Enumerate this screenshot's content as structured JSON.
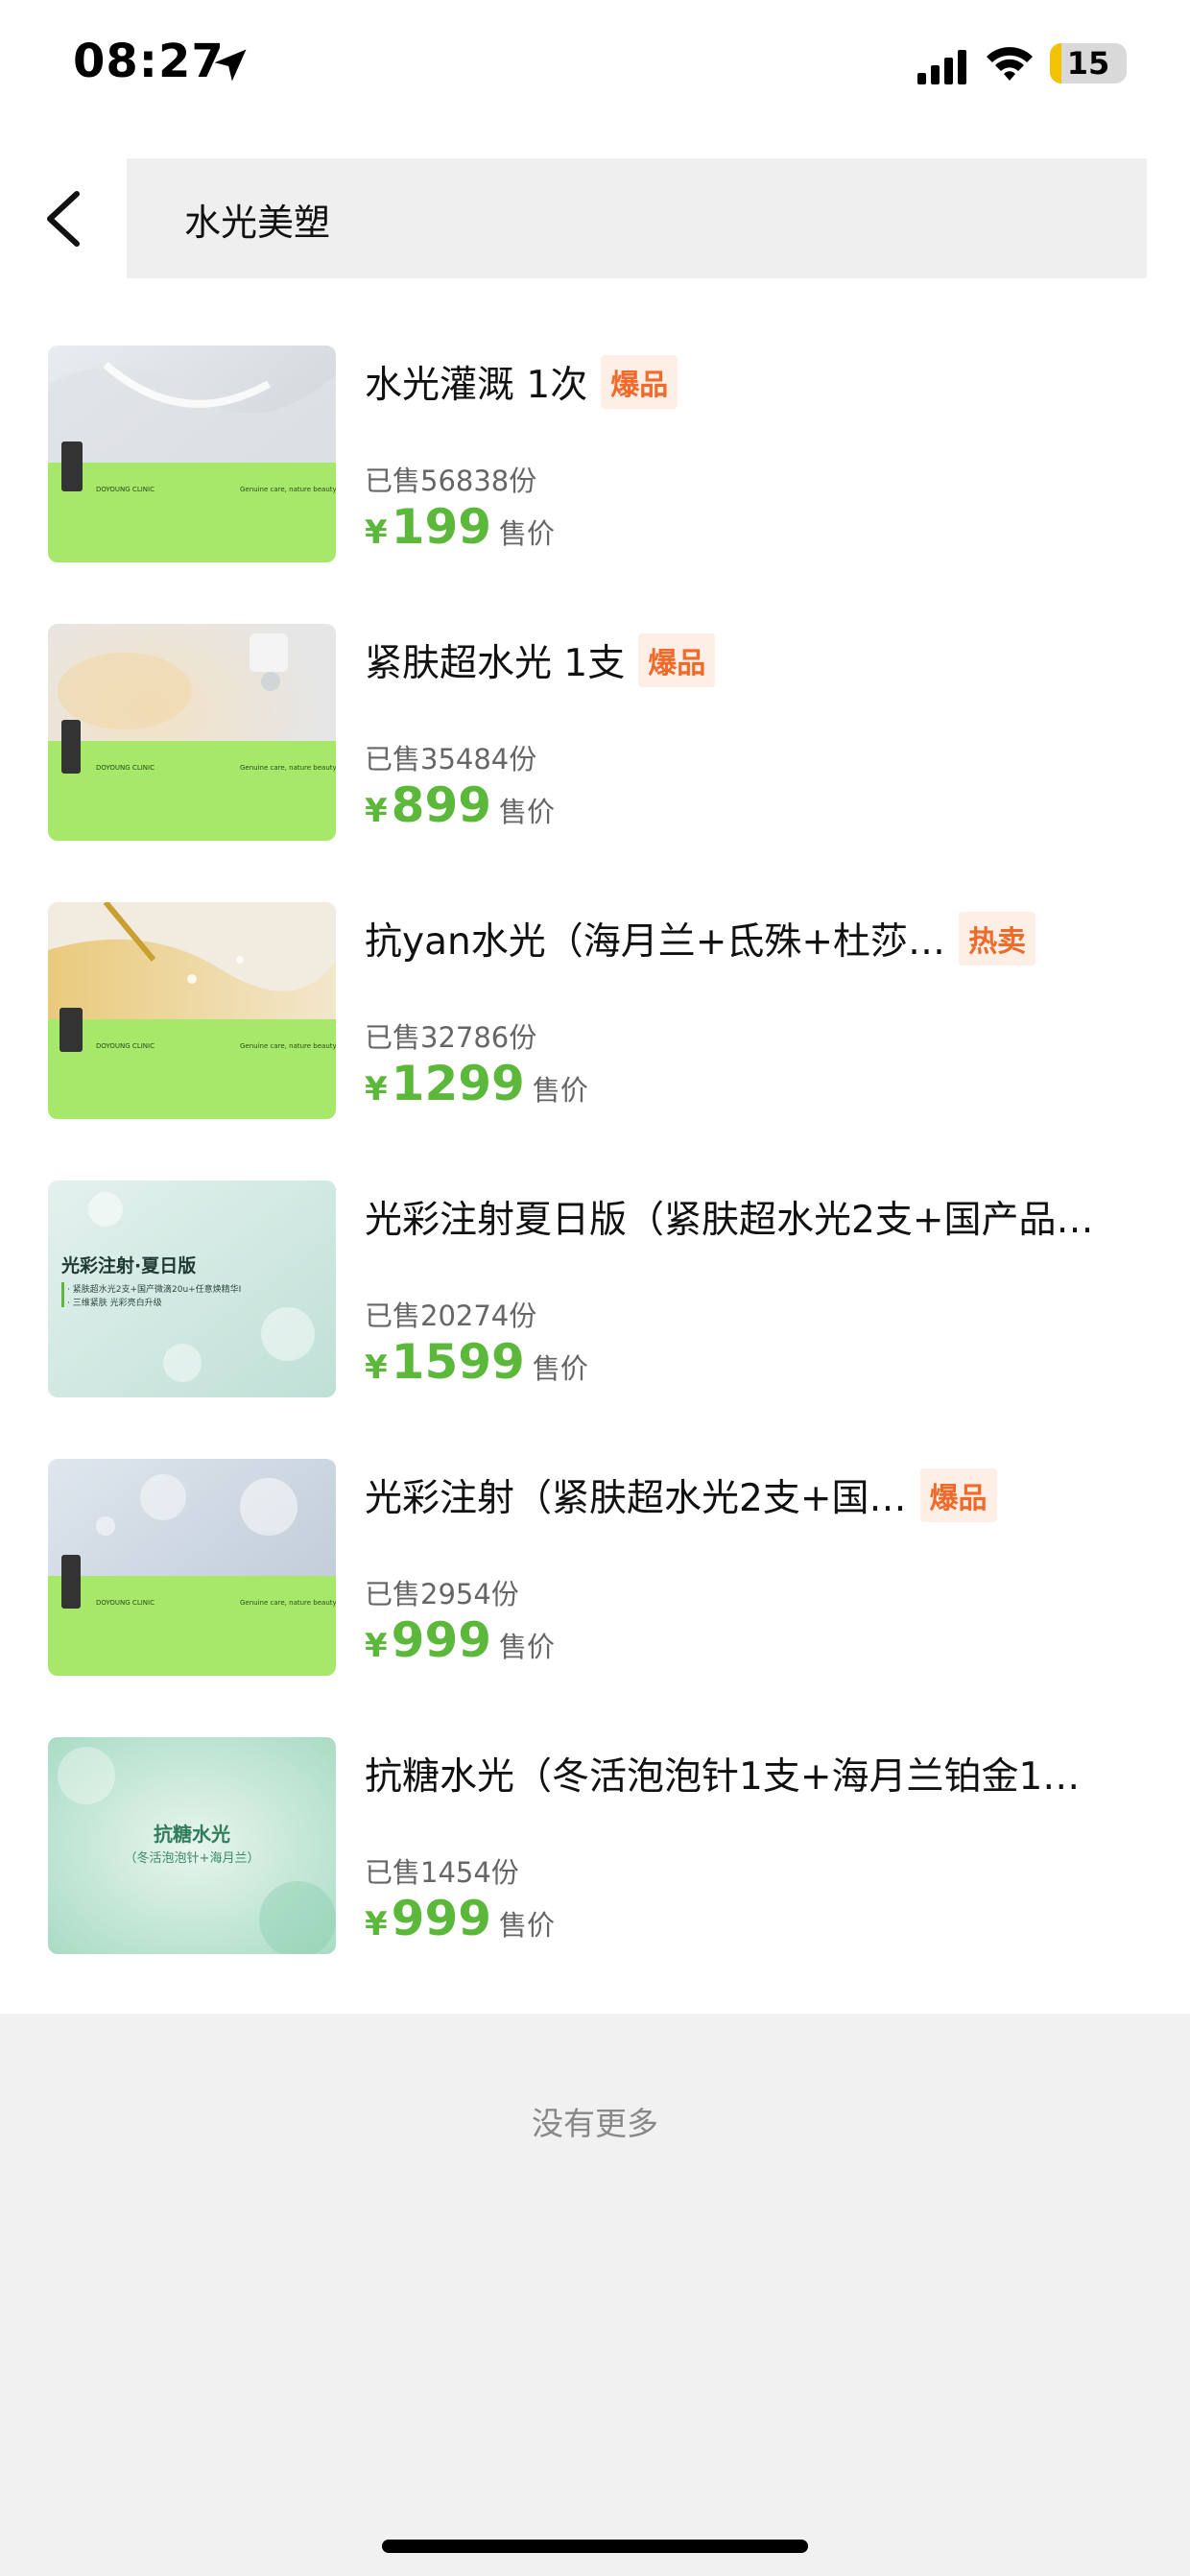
{
  "status_bar": {
    "time": "08:27",
    "battery": "15",
    "battery_level": 0.15
  },
  "search": {
    "query": "水光美塑"
  },
  "products": [
    {
      "title": "水光灌溉 1次",
      "badge": "爆品",
      "sold": "已售56838份",
      "currency": "¥",
      "price": "199",
      "price_label": "售价"
    },
    {
      "title": "紧肤超水光 1支",
      "badge": "爆品",
      "sold": "已售35484份",
      "currency": "¥",
      "price": "899",
      "price_label": "售价"
    },
    {
      "title": "抗yan水光（海月兰+氐殊+杜莎…",
      "badge": "热卖",
      "sold": "已售32786份",
      "currency": "¥",
      "price": "1299",
      "price_label": "售价"
    },
    {
      "title": "光彩注射夏日版（紧肤超水光2支+国产品…",
      "badge": "",
      "sold": "已售20274份",
      "currency": "¥",
      "price": "1599",
      "price_label": "售价"
    },
    {
      "title": "光彩注射（紧肤超水光2支+国…",
      "badge": "爆品",
      "sold": "已售2954份",
      "currency": "¥",
      "price": "999",
      "price_label": "售价"
    },
    {
      "title": "抗糖水光（冬活泡泡针1支+海月兰铂金1…",
      "badge": "",
      "sold": "已售1454份",
      "currency": "¥",
      "price": "999",
      "price_label": "售价"
    }
  ],
  "thumbnails": [
    {
      "caption": "Genuine care, nature beauty.",
      "brand": "DOYOUNG CLINIC"
    },
    {
      "caption": "Genuine care, nature beauty.",
      "brand": "DOYOUNG CLINIC"
    },
    {
      "caption": "Genuine care, nature beauty.",
      "brand": "DOYOUNG CLINIC"
    },
    {
      "heading": "光彩注射·夏日版",
      "line1": "· 紧肤超水光2支+国产微滴20u+任意焕精华I",
      "line2": "· 三维紧肤 光彩亮白升级"
    },
    {
      "caption": "Genuine care, nature beauty.",
      "brand": "DOYOUNG CLINIC"
    },
    {
      "heading": "抗糖水光",
      "sub": "（冬活泡泡针+海月兰）"
    }
  ],
  "footer": {
    "no_more": "没有更多"
  },
  "colors": {
    "price_green": "#5cb83a",
    "badge_orange": "#f06a2a",
    "badge_bg": "#fdeee6",
    "thumb_green": "#a6e86a"
  }
}
